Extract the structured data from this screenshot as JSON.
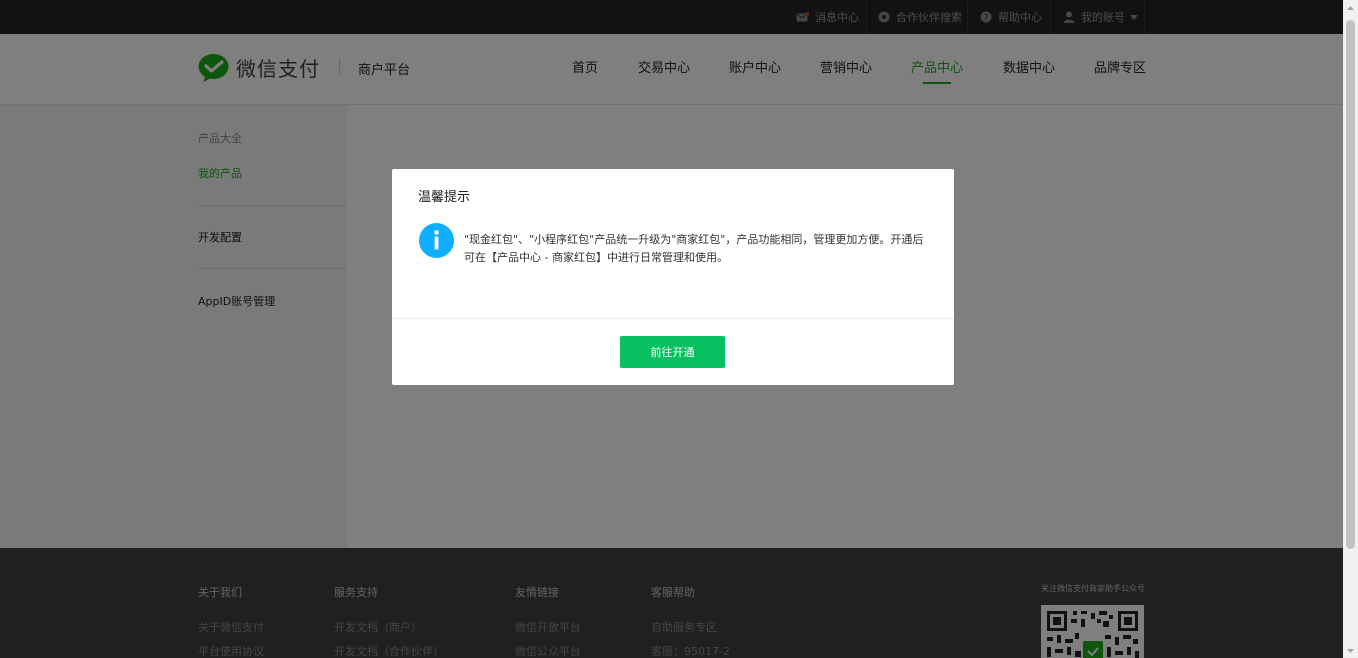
{
  "topbar": {
    "messages": "消息中心",
    "partner_search": "合作伙伴搜索",
    "help": "帮助中心",
    "account": "我的账号"
  },
  "header": {
    "logo_text": "微信支付",
    "platform": "商户平台",
    "nav": [
      "首页",
      "交易中心",
      "账户中心",
      "营销中心",
      "产品中心",
      "数据中心",
      "品牌专区"
    ],
    "active_nav": "产品中心"
  },
  "sidebar": {
    "all_products": "产品大全",
    "my_products": "我的产品",
    "dev_config": "开发配置",
    "appid_manage": "AppID账号管理"
  },
  "footer": {
    "columns": [
      {
        "title": "关于我们",
        "links": [
          "关于微信支付",
          "平台使用协议"
        ]
      },
      {
        "title": "服务支持",
        "links": [
          "开发文档（商户）",
          "开发文档（合作伙伴）"
        ]
      },
      {
        "title": "友情链接",
        "links": [
          "微信开放平台",
          "微信公众平台"
        ]
      },
      {
        "title": "客服帮助",
        "links": [
          "自助服务专区",
          "客服：95017-2"
        ]
      }
    ],
    "qr_title": "关注微信支付商家助手公众号"
  },
  "modal": {
    "title": "温馨提示",
    "message": "\"现金红包\"、\"小程序红包\"产品统一升级为\"商家红包\"，产品功能相同，管理更加方便。开通后可在【产品中心 - 商家红包】中进行日常管理和使用。",
    "button": "前往开通"
  },
  "colors": {
    "brand_green": "#1aad19",
    "button_green": "#07c160",
    "info_blue": "#10aeff",
    "topbar_bg": "#222529",
    "footer_bg": "#3e4143"
  }
}
